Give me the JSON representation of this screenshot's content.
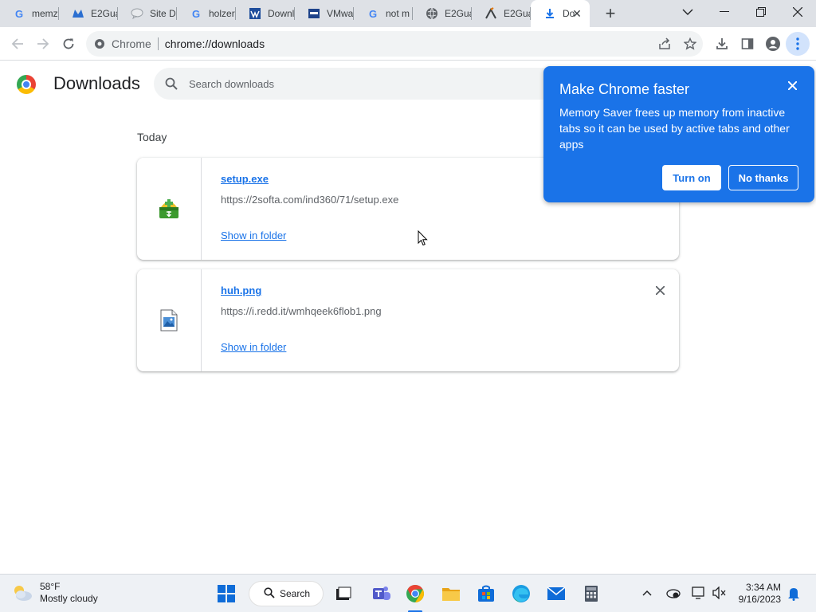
{
  "tabs": [
    {
      "label": "memz",
      "favicon": "google-icon"
    },
    {
      "label": "E2Gua",
      "favicon": "e2guardian-icon"
    },
    {
      "label": "Site Di",
      "favicon": "chat-bubble-icon"
    },
    {
      "label": "holzer",
      "favicon": "google-icon"
    },
    {
      "label": "Downl",
      "favicon": "download-site-icon"
    },
    {
      "label": "VMwa",
      "favicon": "vmware-icon"
    },
    {
      "label": "not m",
      "favicon": "google-icon"
    },
    {
      "label": "E2Gua",
      "favicon": "globe-icon"
    },
    {
      "label": "E2Gua",
      "favicon": "e2guardian-logo-icon"
    },
    {
      "label": "Do",
      "favicon": "download-icon",
      "active": true
    }
  ],
  "omnibox": {
    "chip": "Chrome",
    "url": "chrome://downloads"
  },
  "page": {
    "title": "Downloads",
    "search_placeholder": "Search downloads",
    "section": "Today"
  },
  "downloads": [
    {
      "name": "setup.exe",
      "url": "https://2softa.com/ind360/71/setup.exe",
      "action": "Show in folder",
      "icon": "installer-icon"
    },
    {
      "name": "huh.png",
      "url": "https://i.redd.it/wmhqeek6flob1.png",
      "action": "Show in folder",
      "icon": "image-file-icon"
    }
  ],
  "popup": {
    "title": "Make Chrome faster",
    "body": "Memory Saver frees up memory from inactive tabs so it can be used by active tabs and other apps",
    "primary": "Turn on",
    "secondary": "No thanks"
  },
  "taskbar": {
    "temp": "58°F",
    "condition": "Mostly cloudy",
    "search_label": "Search",
    "time": "3:34 AM",
    "date": "9/16/2023"
  },
  "colors": {
    "accent": "#1a73e8",
    "tabstrip": "#dee1e6",
    "omnibox": "#f1f3f4"
  }
}
